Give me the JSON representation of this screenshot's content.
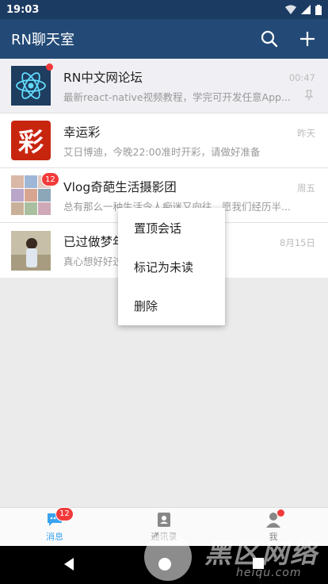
{
  "status_bar": {
    "time": "19:03"
  },
  "app_bar": {
    "title": "RN聊天室",
    "search_icon": "search-icon",
    "add_icon": "plus-icon"
  },
  "chats": [
    {
      "name": "RN中文网论坛",
      "message": "最新react-native视频教程，学完可开发任意App...",
      "time": "00:47",
      "pinned": true,
      "badge": "dot",
      "avatar": "react-logo"
    },
    {
      "name": "幸运彩",
      "message": "艾日博迪，今晚22:00准时开彩，请做好准备",
      "time": "昨天",
      "avatar_text": "彩"
    },
    {
      "name": "Vlog奇葩生活摄影团",
      "message": "总有那么一种生活令人痴迷又向往，愿我们经历半...",
      "time": "周五",
      "badge_count": "12",
      "avatar": "photo-grid"
    },
    {
      "name": "已过做梦年纪",
      "message": "真心想好好过",
      "time": "8月15日",
      "avatar": "person-photo"
    }
  ],
  "context_menu": {
    "items": [
      "置顶会话",
      "标记为未读",
      "删除"
    ]
  },
  "tab_bar": {
    "tabs": [
      {
        "label": "消息",
        "badge_count": "12",
        "active": true
      },
      {
        "label": "通讯录"
      },
      {
        "label": "我",
        "badge": "dot"
      }
    ]
  },
  "watermark": {
    "text": "黑区网络",
    "url": "heiqu.com"
  },
  "colors": {
    "status_bar": "#1c3b63",
    "app_bar": "#234a76",
    "badge": "#f23a3a",
    "active_tab": "#3aa3f0"
  }
}
